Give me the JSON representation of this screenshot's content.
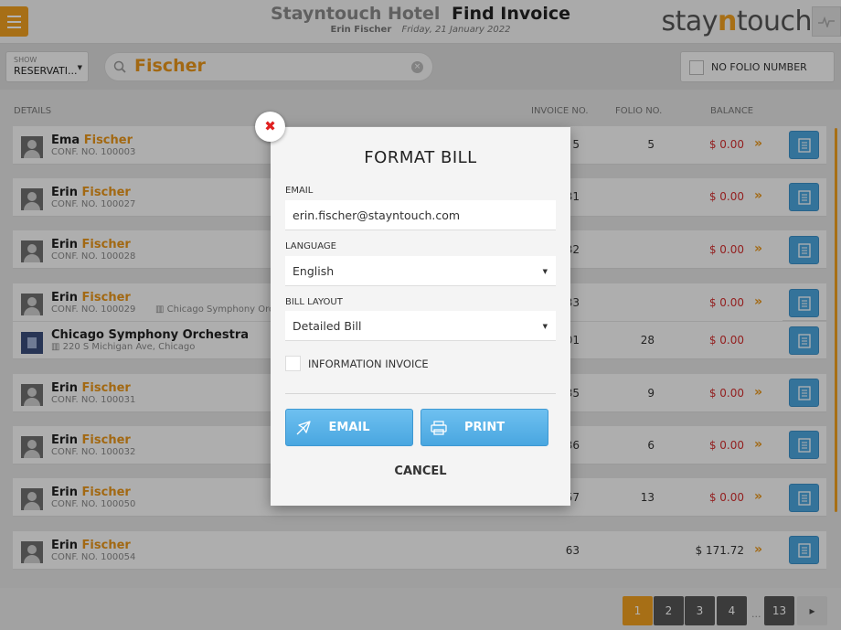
{
  "header": {
    "hotel_name": "Stayntouch Hotel",
    "page_title": "Find Invoice",
    "user": "Erin Fischer",
    "date": "Friday, 21 January 2022",
    "brand_pre": "stay",
    "brand_n": "n",
    "brand_post": "touch"
  },
  "filters": {
    "show_label": "SHOW",
    "show_value": "RESERVATI...",
    "search_value": "Fischer",
    "no_folio_label": "NO FOLIO NUMBER"
  },
  "columns": {
    "details": "DETAILS",
    "invoice_no": "INVOICE NO.",
    "folio_no": "FOLIO NO.",
    "balance": "BALANCE"
  },
  "rows": [
    {
      "first": "Ema",
      "last": "Fischer",
      "conf": "CONF. NO. 100003",
      "extra": "",
      "invoice": "5",
      "folio": "5",
      "balance": "$ 0.00"
    },
    {
      "first": "Erin",
      "last": "Fischer",
      "conf": "CONF. NO. 100027",
      "extra": "",
      "invoice": "31",
      "folio": "",
      "balance": "$ 0.00"
    },
    {
      "first": "Erin",
      "last": "Fischer",
      "conf": "CONF. NO. 100028",
      "extra": "",
      "invoice": "32",
      "folio": "",
      "balance": "$ 0.00"
    },
    {
      "first": "Erin",
      "last": "Fischer",
      "conf": "CONF. NO. 100029",
      "extra": "Chicago Symphony Orc",
      "invoice": "33",
      "folio": "",
      "balance": "$ 0.00"
    },
    {
      "company": "Chicago Symphony Orchestra",
      "address": "220 S Michigan Ave, Chicago",
      "invoice": "01",
      "folio": "28",
      "balance": "$ 0.00"
    },
    {
      "first": "Erin",
      "last": "Fischer",
      "conf": "CONF. NO. 100031",
      "extra": "",
      "invoice": "35",
      "folio": "9",
      "balance": "$ 0.00"
    },
    {
      "first": "Erin",
      "last": "Fischer",
      "conf": "CONF. NO. 100032",
      "extra": "",
      "invoice": "36",
      "folio": "6",
      "balance": "$ 0.00"
    },
    {
      "first": "Erin",
      "last": "Fischer",
      "conf": "CONF. NO. 100050",
      "extra": "",
      "invoice": "57",
      "folio": "13",
      "balance": "$ 0.00"
    },
    {
      "first": "Erin",
      "last": "Fischer",
      "conf": "CONF. NO. 100054",
      "extra": "",
      "invoice": "63",
      "folio": "",
      "balance": "$ 171.72"
    }
  ],
  "pagination": {
    "pages": [
      "1",
      "2",
      "3",
      "4"
    ],
    "dots": "...",
    "last": "13",
    "current": "1"
  },
  "modal": {
    "title": "FORMAT BILL",
    "email_label": "EMAIL",
    "email_value": "erin.fischer@stayntouch.com",
    "language_label": "LANGUAGE",
    "language_value": "English",
    "layout_label": "BILL LAYOUT",
    "layout_value": "Detailed Bill",
    "info_invoice_label": "INFORMATION INVOICE",
    "email_button": "EMAIL",
    "print_button": "PRINT",
    "cancel_button": "CANCEL",
    "close_glyph": "✖"
  },
  "colors": {
    "accent": "#f0a020",
    "name_highlight": "#e8961a",
    "balance_red": "#d32f2f",
    "button_blue": "#4ba5dd"
  }
}
